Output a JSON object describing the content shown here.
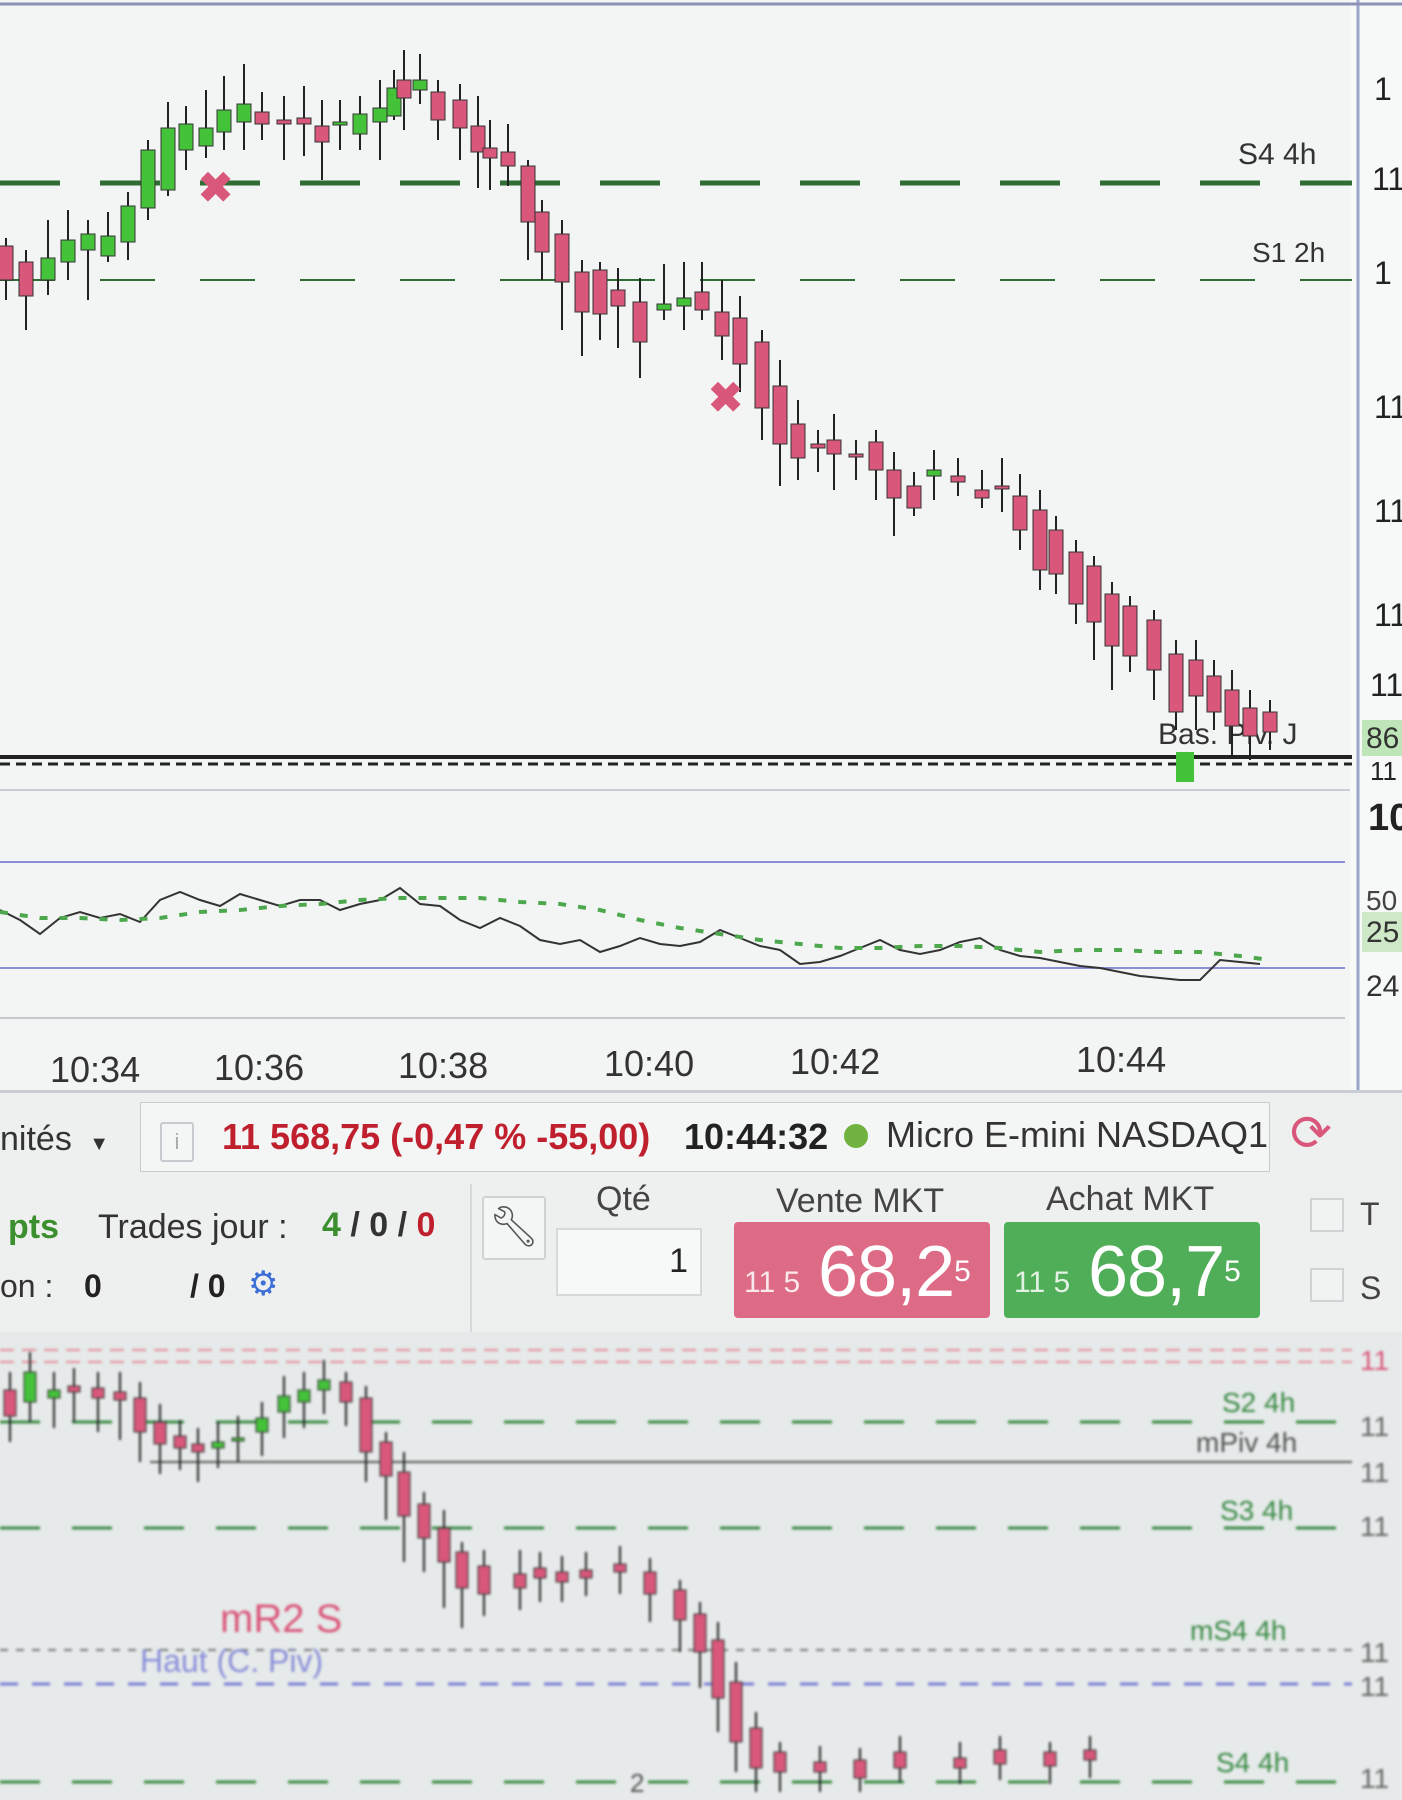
{
  "main_chart": {
    "pivot_labels": [
      "S4 4h",
      "S1 2h",
      "Bas. Piv. J"
    ],
    "axis_price_labels": [
      "1",
      "11",
      "1",
      "11",
      "11",
      "11",
      "11",
      "86",
      "11",
      "10"
    ],
    "indicator_axis_labels": [
      "50",
      "25",
      "24"
    ],
    "time_labels": [
      "10:34",
      "10:36",
      "10:38",
      "10:40",
      "10:42",
      "10:44"
    ]
  },
  "toolbar": {
    "units_label": "nités",
    "info_icon": "info-icon",
    "price_change": "11 568,75 (-0,47 % -55,00)",
    "time": "10:44:32",
    "status_dot_color": "#6fb23f",
    "instrument": "Micro E-mini NASDAQ1",
    "refresh_icon": "refresh-icon"
  },
  "order_panel": {
    "pts_label": "pts",
    "trades_label": "Trades jour :",
    "trades_counts": [
      "4",
      "0",
      "0"
    ],
    "position_label": "on :",
    "position_value": "0",
    "position_suffix": "/ 0",
    "gear_icon": "gears-icon",
    "wrench_icon": "wrench-icon",
    "qty_label": "Qté",
    "qty_value": "1",
    "sell_label": "Vente MKT",
    "sell_small": "11 5",
    "sell_big": "68,2",
    "sell_sup": "5",
    "buy_label": "Achat MKT",
    "buy_small": "11 5",
    "buy_big": "68,7",
    "buy_sup": "5",
    "side_labels": [
      "T",
      "S"
    ],
    "colors": {
      "sell": "#de6b85",
      "buy": "#4fae57",
      "gain": "#3c8f2f",
      "loss": "#c0202e"
    }
  },
  "bottom_chart": {
    "pivot_labels": [
      "S2 4h",
      "mPiv 4h",
      "S3 4h",
      "mS4 4h",
      "S4 4h"
    ],
    "axis_labels": [
      "11",
      "11",
      "11",
      "11",
      "11",
      "11",
      "11"
    ],
    "annotations": [
      "mR2 S",
      "Haut (C. Piv)",
      "2"
    ]
  },
  "colors": {
    "bull": "#44c23a",
    "bear": "#d9577a",
    "pivot_green": "#2f6d35",
    "indicator_line": "#8a8fd9"
  }
}
